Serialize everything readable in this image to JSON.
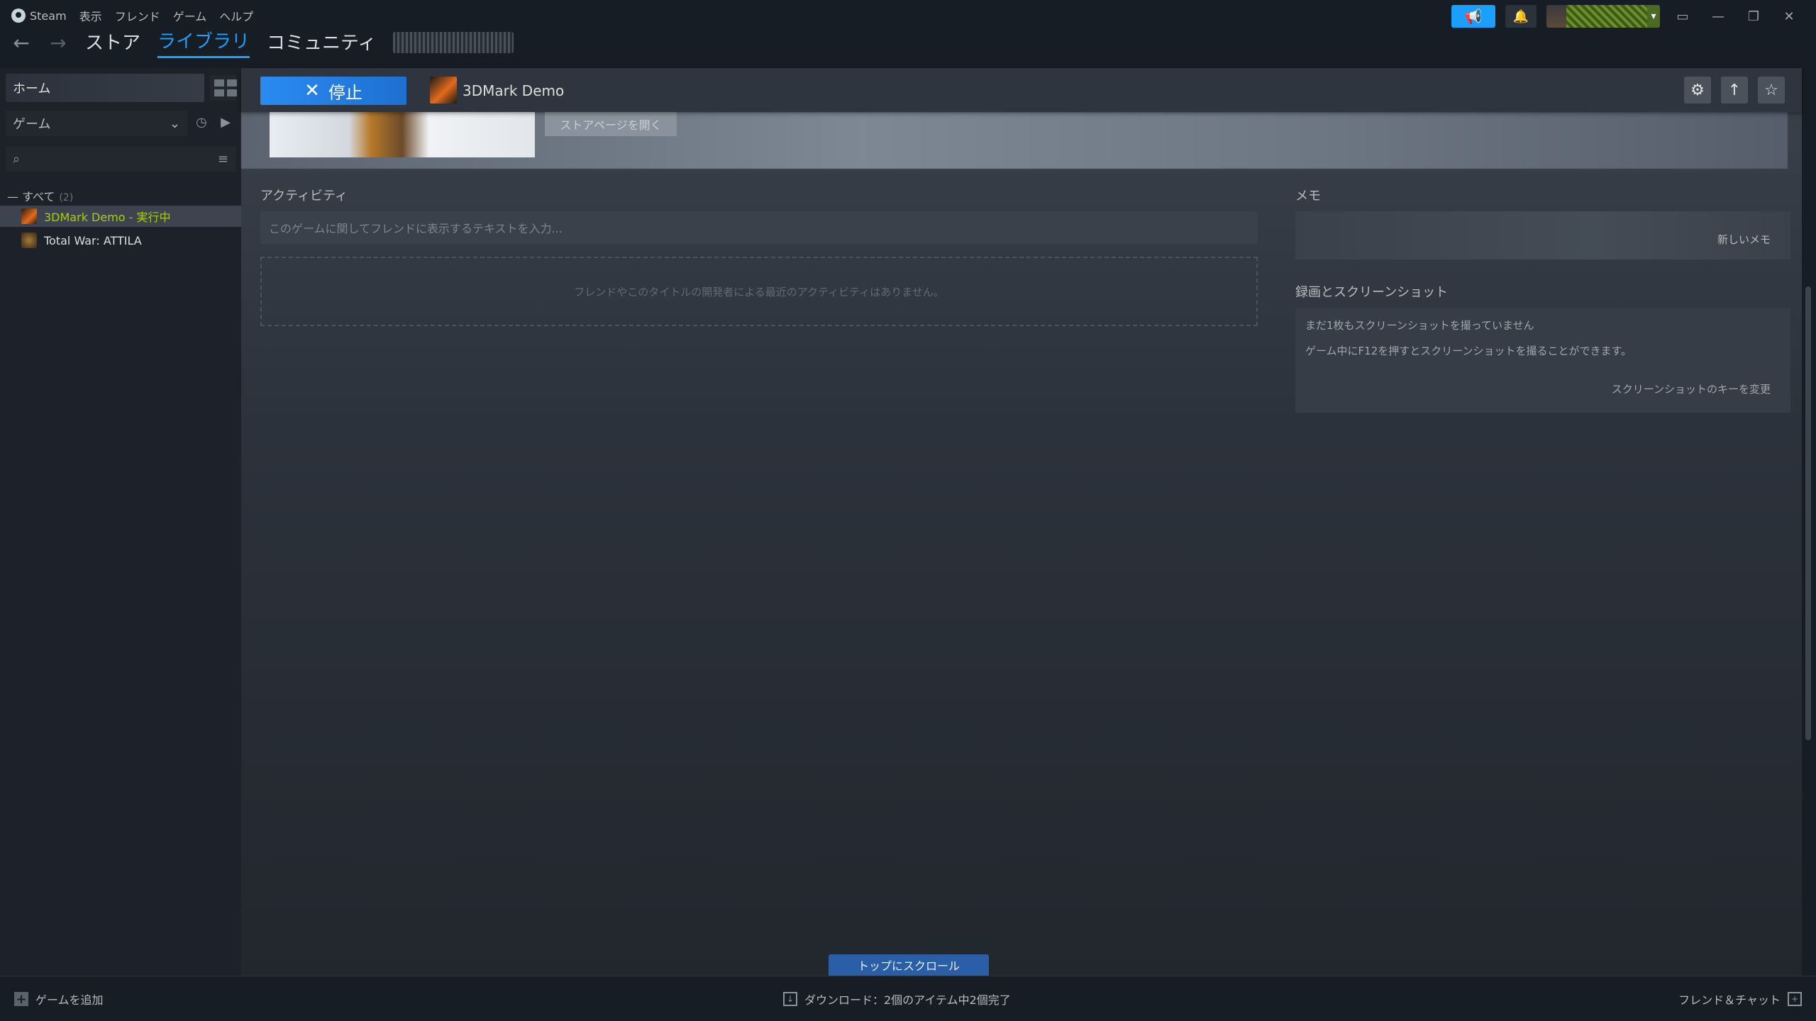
{
  "menubar": {
    "steam": "Steam",
    "view": "表示",
    "friends": "フレンド",
    "games": "ゲーム",
    "help": "ヘルプ"
  },
  "nav": {
    "back": "←",
    "forward": "→",
    "store": "ストア",
    "library": "ライブラリ",
    "community": "コミュニティ"
  },
  "topRight": {
    "announce_icon": "📢",
    "bell_icon": "🔔",
    "caret": "▾",
    "monitor": "▭",
    "minimize": "—",
    "restore": "❐",
    "close": "✕"
  },
  "sidebar": {
    "home": "ホーム",
    "filter_label": "ゲーム",
    "filter_caret": "⌄",
    "clock_icon": "◷",
    "play_icon": "▶",
    "search_icon": "⌕",
    "filter_icon": "≡",
    "all_label": "— すべて",
    "all_count": "(2)",
    "games": [
      {
        "name": "3DMark Demo",
        "state": " - 実行中"
      },
      {
        "name": "Total War: ATTILA",
        "state": ""
      }
    ]
  },
  "gamebar": {
    "stop_x": "✕",
    "stop_label": "停止",
    "title": "3DMark Demo",
    "settings_icon": "⚙",
    "up_icon": "↑",
    "star_icon": "☆"
  },
  "hero": {
    "store_page": "ストアページを開く"
  },
  "activity": {
    "title": "アクティビティ",
    "placeholder": "このゲームに関してフレンドに表示するテキストを入力...",
    "empty": "フレンドやこのタイトルの開発者による最近のアクティビティはありません。"
  },
  "memo": {
    "title": "メモ",
    "new_memo": "新しいメモ"
  },
  "screenshots": {
    "title": "録画とスクリーンショット",
    "line1": "まだ1枚もスクリーンショットを撮っていません",
    "line2": "ゲーム中にF12を押すとスクリーンショットを撮ることができます。",
    "change_key": "スクリーンショットのキーを変更"
  },
  "scroll_top": "トップにスクロール",
  "bottombar": {
    "add_game": "ゲームを追加",
    "plus": "+",
    "download": "ダウンロード：2個のアイテム中2個完了",
    "download_icon": "↓",
    "friends_chat": "フレンド＆チャット",
    "friends_icon": "+"
  }
}
